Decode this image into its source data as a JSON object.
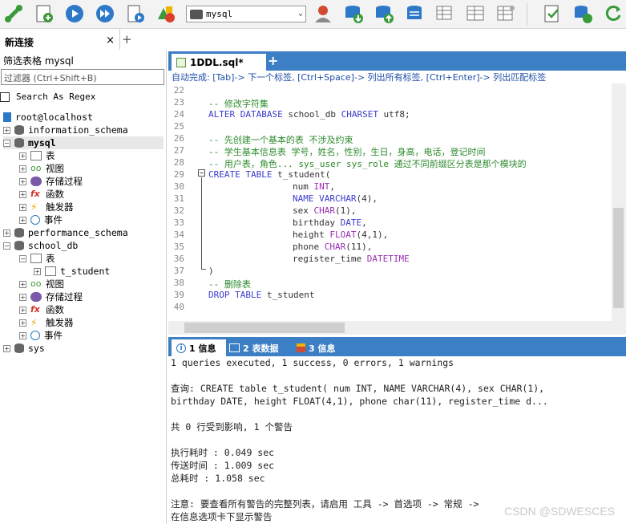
{
  "toolbar": {
    "db_selected": "mysql"
  },
  "connection_tab": {
    "label": "新连接",
    "close": "×",
    "add": "+"
  },
  "left": {
    "filter_label": "筛选表格 mysql",
    "filter_placeholder": "过滤器 (Ctrl+Shift+B)",
    "regex_label": "Search As Regex",
    "tree": {
      "root": "root@localhost",
      "information_schema": "information_schema",
      "mysql": "mysql",
      "mysql_children": [
        "表",
        "视图",
        "存储过程",
        "函数",
        "触发器",
        "事件"
      ],
      "performance_schema": "performance_schema",
      "school_db": "school_db",
      "school_tables": "表",
      "t_student": "t_student",
      "school_children": [
        "视图",
        "存储过程",
        "函数",
        "触发器",
        "事件"
      ],
      "sys": "sys"
    }
  },
  "editor": {
    "tab_label": "1DDL.sql*",
    "add": "+",
    "hint": "自动完成: [Tab]-> 下一个标签, [Ctrl+Space]-> 列出所有标签, [Ctrl+Enter]-> 列出匹配标签",
    "lines": [
      "22",
      "23",
      "24",
      "25",
      "26",
      "27",
      "28",
      "29",
      "30",
      "31",
      "32",
      "33",
      "34",
      "35",
      "36",
      "37",
      "38",
      "39",
      "40"
    ],
    "code": {
      "l23": "-- 修改字符集",
      "l24a": "ALTER DATABASE",
      "l24b": " school_db ",
      "l24c": "CHARSET",
      "l24d": " utf8;",
      "l26": "-- 先创建一个基本的表 不涉及约束",
      "l27": "-- 学生基本信息表 学号，姓名，性别，生日，身高，电话，登记时间",
      "l28a": "-- 用户表，角色... sys_user sys_role",
      "l28b": " 通过不同前缀区分表是那个模块的",
      "l29a": "CREATE TABLE",
      "l29b": " t_student(",
      "l30a": "num ",
      "l30b": "INT",
      "l30c": ",",
      "l31a": "NAME VARCHAR",
      "l31b": "(4),",
      "l32a": "sex ",
      "l32b": "CHAR",
      "l32c": "(1),",
      "l33a": "birthday ",
      "l33b": "DATE",
      "l33c": ",",
      "l34a": "height ",
      "l34b": "FLOAT",
      "l34c": "(4,1),",
      "l35a": "phone ",
      "l35b": "CHAR",
      "l35c": "(11),",
      "l36a": "register_time ",
      "l36b": "DATETIME",
      "l37": ")",
      "l38": "-- 删除表",
      "l39a": "DROP TABLE",
      "l39b": " t_student"
    }
  },
  "results": {
    "tab1": "1 信息",
    "tab2": "2 表数据",
    "tab3": "3 信息",
    "summary": "1 queries executed, 1 success, 0 errors, 1 warnings",
    "query1": "查询: CREATE table t_student( num INT, NAME VARCHAR(4), sex CHAR(1),",
    "query2": "birthday DATE, height FLOAT(4,1), phone char(11), register_time d...",
    "affected": "共 0 行受到影响, 1 个警告",
    "exec_time": "执行耗时   : 0.049 sec",
    "transfer_time": "传送时间   : 1.009 sec",
    "total_time": "总耗时      : 1.058 sec",
    "note1": "注意: 要查看所有警告的完整列表，请启用 工具 -> 首选项 -> 常规 ->",
    "note2": "在信息选项卡下显示警告",
    "watermark": "CSDN @SDWESCES"
  }
}
